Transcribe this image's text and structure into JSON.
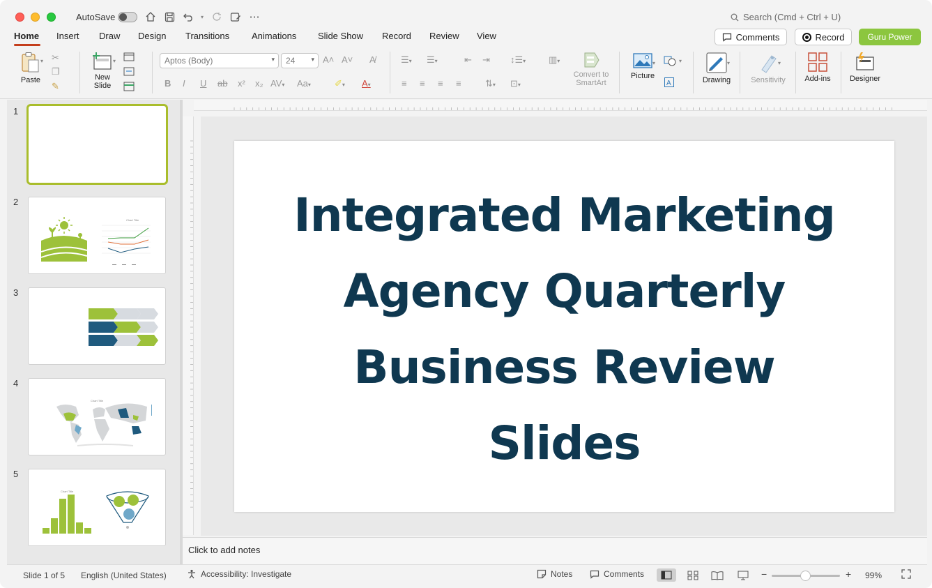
{
  "titlebar": {
    "autosave_label": "AutoSave",
    "search_placeholder": "Search (Cmd + Ctrl + U)"
  },
  "tabs": [
    "Home",
    "Insert",
    "Draw",
    "Design",
    "Transitions",
    "Animations",
    "Slide Show",
    "Record",
    "Review",
    "View"
  ],
  "tab_actions": {
    "comments": "Comments",
    "record": "Record",
    "guru": "Guru Power"
  },
  "ribbon": {
    "paste": "Paste",
    "new_slide": "New Slide",
    "font_name": "Aptos (Body)",
    "font_size": "24",
    "convert_smartart": "Convert to SmartArt",
    "picture": "Picture",
    "drawing": "Drawing",
    "sensitivity": "Sensitivity",
    "addins": "Add-ins",
    "designer": "Designer"
  },
  "thumbnails": [
    {
      "number": "1"
    },
    {
      "number": "2",
      "chart_title": "Chart Title"
    },
    {
      "number": "3"
    },
    {
      "number": "4",
      "chart_title": "Chart Title"
    },
    {
      "number": "5",
      "chart_title": "Chart Title"
    }
  ],
  "slide": {
    "title_lines": [
      "Integrated Marketing",
      "Agency Quarterly",
      "Business Review",
      "Slides"
    ]
  },
  "notes": {
    "placeholder": "Click to add notes"
  },
  "status": {
    "slide_count": "Slide 1 of 5",
    "language": "English (United States)",
    "accessibility": "Accessibility: Investigate",
    "notes": "Notes",
    "comments": "Comments",
    "zoom": "99%"
  },
  "colors": {
    "title_text": "#0f3850",
    "accent_green": "#8cc63f",
    "tab_underline": "#c43e1c",
    "thumb_green": "#9dc13a",
    "thumb_blue": "#1f5a7e"
  }
}
